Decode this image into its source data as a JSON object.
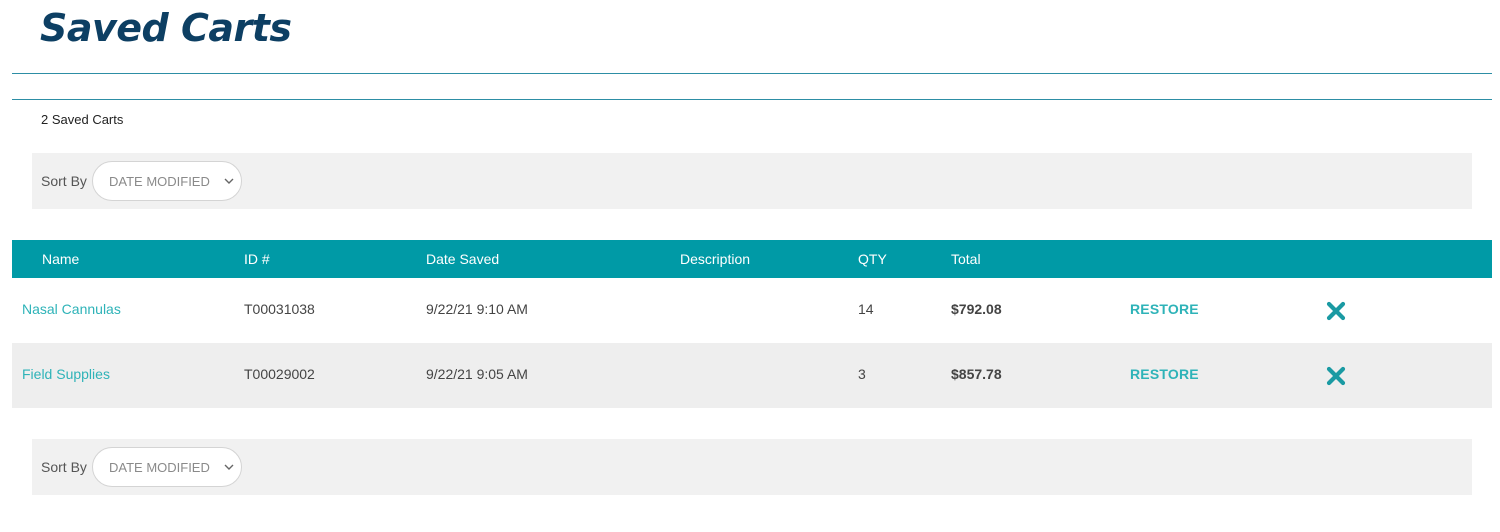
{
  "page": {
    "title": "Saved Carts",
    "count_label": "2 Saved Carts"
  },
  "sort": {
    "label": "Sort By",
    "selected": "DATE MODIFIED"
  },
  "table": {
    "columns": [
      "Name",
      "ID #",
      "Date Saved",
      "Description",
      "QTY",
      "Total"
    ],
    "rows": [
      {
        "name": "Nasal Cannulas",
        "id": "T00031038",
        "date_saved": "9/22/21 9:10 AM",
        "description": "",
        "qty": "14",
        "total": "$792.08",
        "restore_label": "RESTORE"
      },
      {
        "name": "Field Supplies",
        "id": "T00029002",
        "date_saved": "9/22/21 9:05 AM",
        "description": "",
        "qty": "3",
        "total": "$857.78",
        "restore_label": "RESTORE"
      }
    ]
  },
  "colors": {
    "title": "#0d3f63",
    "header_bg": "#009aa6",
    "link": "#2eb3b8",
    "rule": "#2d8ea5",
    "delete_icon": "#1a9aa3"
  },
  "icons": {
    "delete": "close-x-icon",
    "sort_dropdown": "chevron-down-icon"
  }
}
